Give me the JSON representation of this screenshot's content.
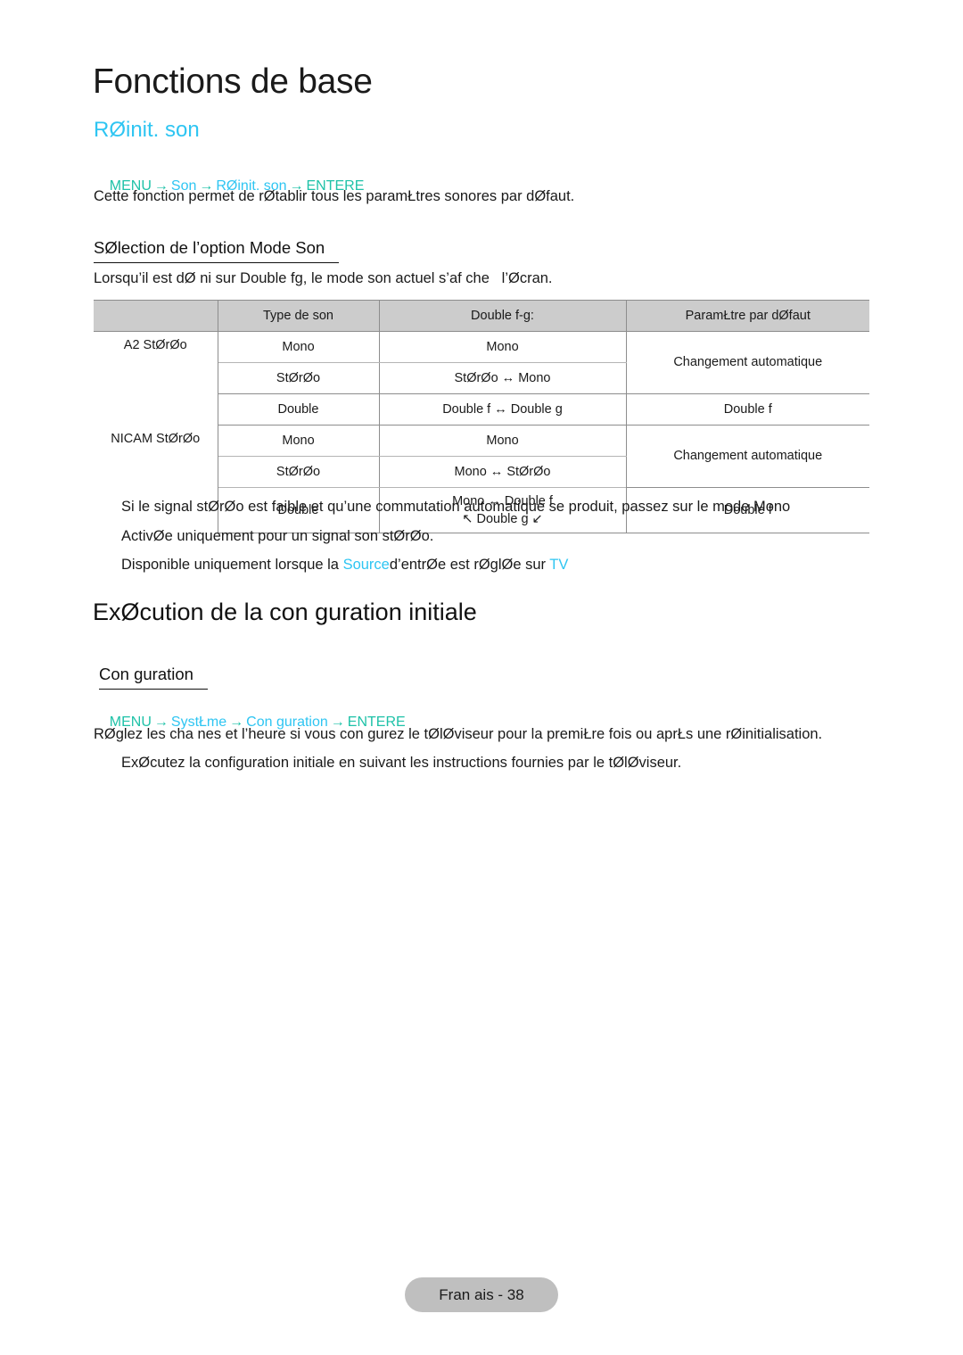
{
  "document": {
    "page_title": "Fonctions de base",
    "footer": "Fran ais - 38"
  },
  "section_sound_reset": {
    "heading": "RØinit. son",
    "breadcrumb": {
      "menu": "MENU",
      "arrow": "→",
      "item1": "Son",
      "item2": "RØinit. son",
      "enter": "ENTERE"
    },
    "description": "Cette fonction permet de rØtablir tous les paramŁtres sonores par dØfaut."
  },
  "subsection_sound_mode": {
    "heading": "SØlection de l’option Mode Son",
    "description": "Lorsqu’il est dØ ni sur Double fg, le mode son actuel s’af che   l’Øcran.",
    "table": {
      "headers": [
        "",
        "Type de son",
        "Double f-g:",
        "ParamŁtre par dØfaut"
      ],
      "groups": [
        {
          "name": "A2 StØrØo",
          "rows": [
            {
              "type": "Mono",
              "double": "Mono",
              "default": "Changement automatique"
            },
            {
              "type": "StØrØo",
              "double": "StØrØo ↔ Mono",
              "default": ""
            },
            {
              "type": "Double",
              "double": "Double f ↔ Double g",
              "default": "Double f"
            }
          ]
        },
        {
          "name": "NICAM StØrØo",
          "rows": [
            {
              "type": "Mono",
              "double": "Mono",
              "default": "Changement automatique"
            },
            {
              "type": "StØrØo",
              "double": "Mono ↔ StØrØo",
              "default": ""
            },
            {
              "type": "Double",
              "double": "Mono ↔ Double f\n↖ Double g ↙",
              "default": "Double f"
            }
          ]
        }
      ]
    },
    "notes": [
      "Si le signal stØrØo est faible et qu’une commutation automatique se produit, passez sur le mode Mono",
      "ActivØe uniquement pour un signal son stØrØo."
    ],
    "note_source": {
      "prefix": "Disponible uniquement lorsque la ",
      "highlight1": "Source",
      "middle": "d’entrØe est rØglØe sur ",
      "highlight2": "TV"
    }
  },
  "section_initial_setup": {
    "heading": "ExØcution de la con guration initiale",
    "subheading": "Con guration",
    "breadcrumb": {
      "menu": "MENU",
      "arrow": "→",
      "item1": "SystŁme",
      "item2": "Con guration",
      "enter": "ENTERE"
    },
    "paragraph1": "RØglez les cha nes et l’heure si vous con gurez le tØlØviseur pour la premiŁre fois ou aprŁs une rØinitialisation.",
    "paragraph2": "ExØcutez la configuration initiale en suivant les instructions fournies par le tØlØviseur."
  },
  "colors": {
    "cyan": "#2ec5f2",
    "teal": "#1fc2a8",
    "table_header_bg": "#cccccc",
    "footer_pill_bg": "#bfbfbf"
  }
}
